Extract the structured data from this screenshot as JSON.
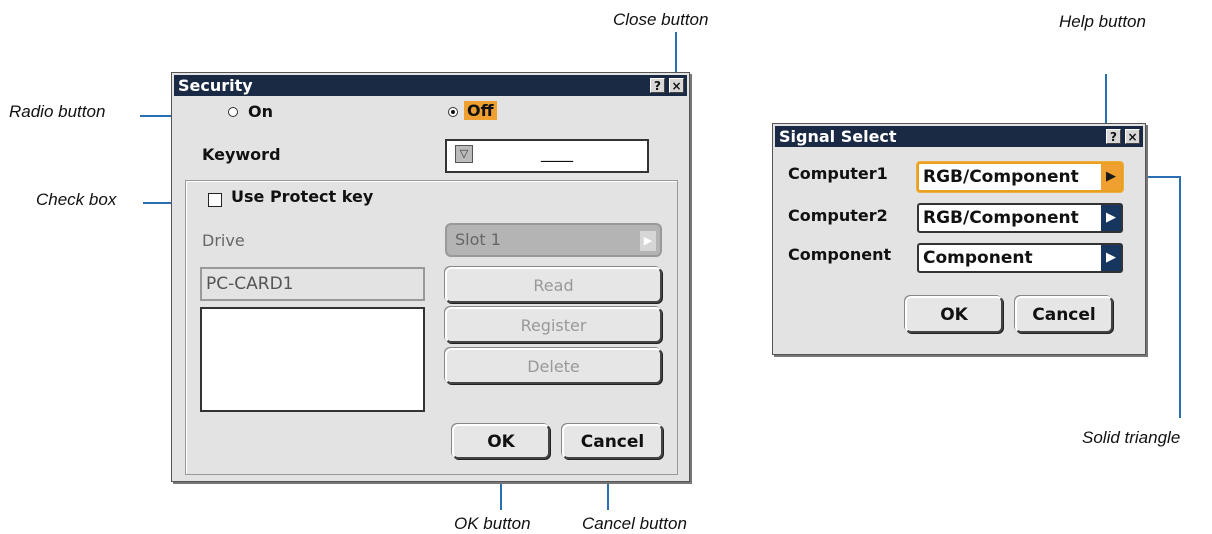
{
  "callouts": {
    "close_button": "Close button",
    "help_button": "Help button",
    "radio_button": "Radio button",
    "check_box": "Check box",
    "ok_button": "OK button",
    "cancel_button": "Cancel button",
    "solid_triangle": "Solid triangle"
  },
  "security": {
    "title": "Security",
    "help_glyph": "?",
    "close_glyph": "×",
    "on_label": "On",
    "off_label": "Off",
    "selected": "Off",
    "keyword_label": "Keyword",
    "keyword_icon_glyph": "▽",
    "keyword_value": "____",
    "use_protect_key_label": "Use Protect key",
    "use_protect_key_checked": false,
    "drive_label": "Drive",
    "slot_value": "Slot 1",
    "slot_arrow": "▶",
    "card_value": "PC-CARD1",
    "read_label": "Read",
    "register_label": "Register",
    "delete_label": "Delete",
    "ok_label": "OK",
    "cancel_label": "Cancel"
  },
  "signal_select": {
    "title": "Signal Select",
    "help_glyph": "?",
    "close_glyph": "×",
    "rows": [
      {
        "label": "Computer1",
        "value": "RGB/Component",
        "arrow": "▶"
      },
      {
        "label": "Computer2",
        "value": "RGB/Component",
        "arrow": "▶"
      },
      {
        "label": "Component",
        "value": "Component",
        "arrow": "▶"
      }
    ],
    "ok_label": "OK",
    "cancel_label": "Cancel"
  },
  "colors": {
    "titlebar": "#1b2a44",
    "focus_accent": "#f0a030",
    "arrow_box": "#17365f",
    "callout_line": "#2a6fb0"
  }
}
